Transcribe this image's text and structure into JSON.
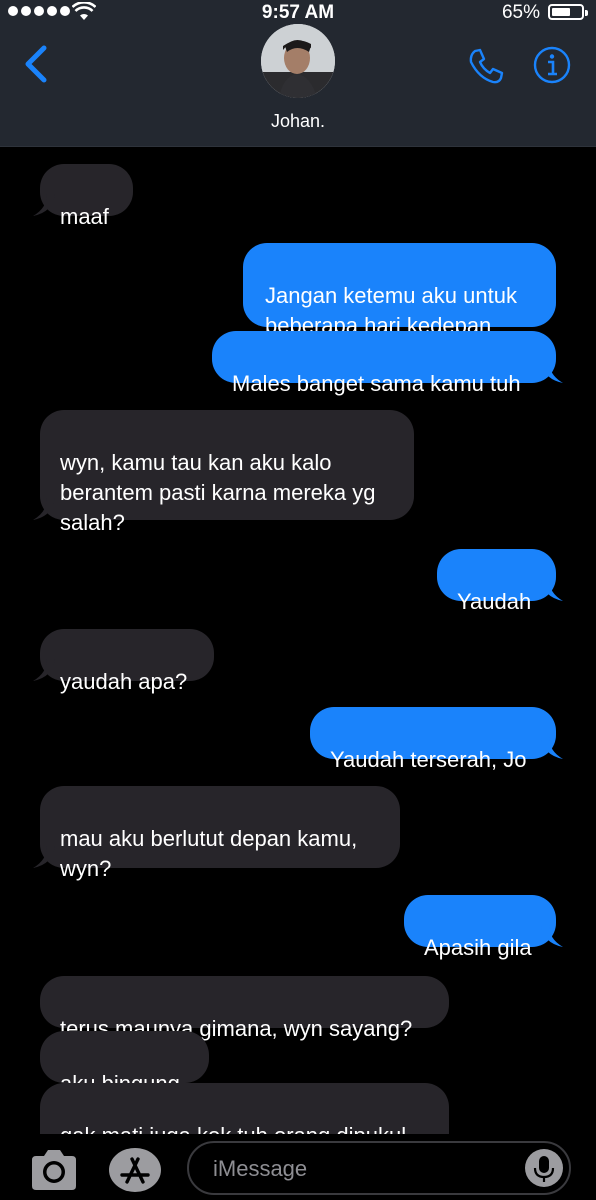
{
  "status_bar": {
    "time": "9:57 AM",
    "battery_percent": "65%",
    "battery_level": 0.65
  },
  "header": {
    "contact_name": "Johan.",
    "accent_color": "#1a83fb"
  },
  "messages": [
    {
      "direction": "incoming",
      "text": "maaf"
    },
    {
      "direction": "outgoing",
      "text": "Jangan ketemu aku untuk\nbeberapa hari kedepan"
    },
    {
      "direction": "outgoing",
      "text": "Males banget sama kamu tuh"
    },
    {
      "direction": "incoming",
      "text": "wyn, kamu tau kan aku kalo\nberantem pasti karna mereka yg\nsalah?"
    },
    {
      "direction": "outgoing",
      "text": "Yaudah"
    },
    {
      "direction": "incoming",
      "text": "yaudah apa?"
    },
    {
      "direction": "outgoing",
      "text": "Yaudah terserah, Jo"
    },
    {
      "direction": "incoming",
      "text": "mau aku berlutut depan kamu,\nwyn?"
    },
    {
      "direction": "outgoing",
      "text": "Apasih gila"
    },
    {
      "direction": "incoming",
      "text": "terus maunya gimana, wyn sayang?"
    },
    {
      "direction": "incoming",
      "text": "aku bingung"
    },
    {
      "direction": "incoming",
      "text": "gak mati juga kok tuh orang dipukul"
    }
  ],
  "input": {
    "placeholder": "iMessage"
  }
}
